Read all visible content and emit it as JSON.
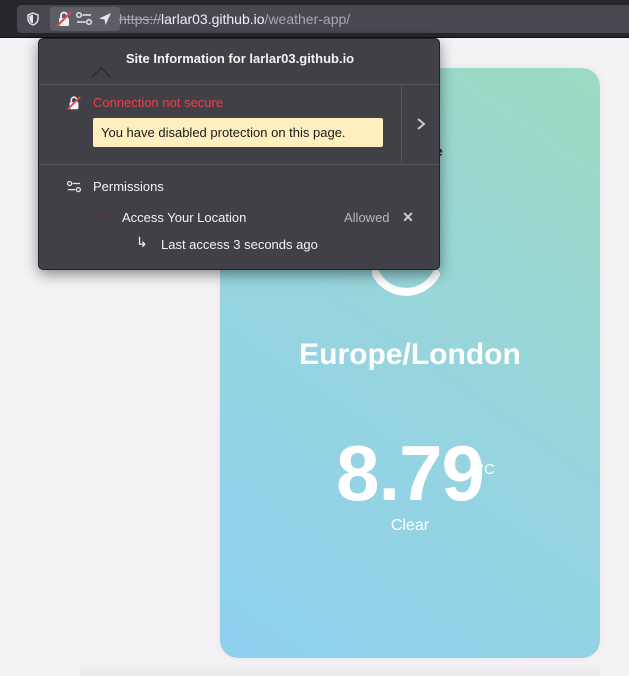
{
  "toolbar": {
    "url_scheme": "https://",
    "url_host": "larlar03.github.io",
    "url_path": "/weather-app/",
    "icons": [
      "shield-icon",
      "insecure-lock-icon",
      "permissions-icon",
      "location-arrow-icon"
    ]
  },
  "popup": {
    "title": "Site Information for larlar03.github.io",
    "connection_status": "Connection not secure",
    "warning": "You have disabled protection on this page.",
    "permissions_header": "Permissions",
    "permission": {
      "name": "Access Your Location",
      "state": "Allowed",
      "last_access": "Last access 3 seconds ago"
    }
  },
  "weather": {
    "partial_heading": "e",
    "timezone": "Europe/London",
    "temperature": "8.79",
    "unit": "°C",
    "description": "Clear"
  },
  "colors": {
    "accent_error": "#e9414a",
    "warning_bg": "#ffefbf",
    "popup_bg": "#414046",
    "card_gradient_start": "#9ddbc1",
    "card_gradient_end": "#8fd0ef"
  }
}
